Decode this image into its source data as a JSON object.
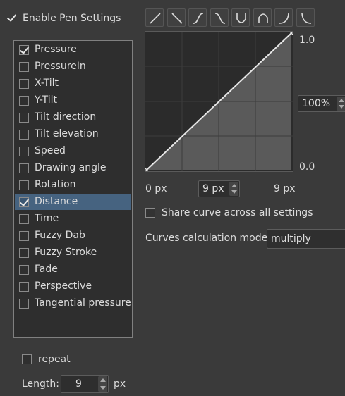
{
  "enable_pen_settings": {
    "label": "Enable Pen Settings",
    "checked": true
  },
  "sensors": [
    {
      "label": "Pressure",
      "checked": true,
      "selected": false
    },
    {
      "label": "PressureIn",
      "checked": false,
      "selected": false
    },
    {
      "label": "X-Tilt",
      "checked": false,
      "selected": false
    },
    {
      "label": "Y-Tilt",
      "checked": false,
      "selected": false
    },
    {
      "label": "Tilt direction",
      "checked": false,
      "selected": false
    },
    {
      "label": "Tilt elevation",
      "checked": false,
      "selected": false
    },
    {
      "label": "Speed",
      "checked": false,
      "selected": false
    },
    {
      "label": "Drawing angle",
      "checked": false,
      "selected": false
    },
    {
      "label": "Rotation",
      "checked": false,
      "selected": false
    },
    {
      "label": "Distance",
      "checked": true,
      "selected": true
    },
    {
      "label": "Time",
      "checked": false,
      "selected": false
    },
    {
      "label": "Fuzzy Dab",
      "checked": false,
      "selected": false
    },
    {
      "label": "Fuzzy Stroke",
      "checked": false,
      "selected": false
    },
    {
      "label": "Fade",
      "checked": false,
      "selected": false
    },
    {
      "label": "Perspective",
      "checked": false,
      "selected": false
    },
    {
      "label": "Tangential pressure",
      "checked": false,
      "selected": false
    }
  ],
  "curve_presets": [
    "linear-up-icon",
    "linear-down-icon",
    "s-curve-up-icon",
    "s-curve-down-icon",
    "u-curve-icon",
    "arch-curve-icon",
    "j-curve-icon",
    "l-curve-icon"
  ],
  "curve": {
    "y_max_label": "1.0",
    "y_min_label": "0.0",
    "x_min_label": "0 px",
    "x_max_label": "9 px",
    "x_spin_value": "9 px",
    "y_spin_value": "100%"
  },
  "share_curve": {
    "label": "Share curve across all settings",
    "checked": false
  },
  "calc_mode": {
    "label": "Curves calculation mode:",
    "value": "multiply"
  },
  "repeat": {
    "label": "repeat",
    "checked": false
  },
  "length": {
    "label": "Length:",
    "value": "9",
    "unit": "px"
  },
  "colors": {
    "selection": "#466380",
    "background": "#3a3a3a",
    "curve_line": "#e6e6e6"
  }
}
